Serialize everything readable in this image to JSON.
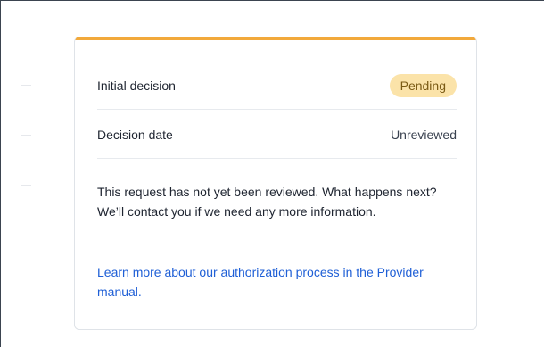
{
  "card": {
    "accent_color": "#f2a93b",
    "rows": [
      {
        "label": "Initial decision",
        "value": "Pending",
        "value_style": "badge"
      },
      {
        "label": "Decision date",
        "value": "Unreviewed",
        "value_style": "text"
      }
    ],
    "message": "This request has not yet been reviewed. What happens next? We’ll contact you if we need any more information.",
    "link_text": "Learn more about our authorization process in the Provider manual."
  },
  "colors": {
    "badge_background": "#fbe3a9",
    "badge_text": "#7a5a14",
    "link": "#1f5fd6"
  }
}
